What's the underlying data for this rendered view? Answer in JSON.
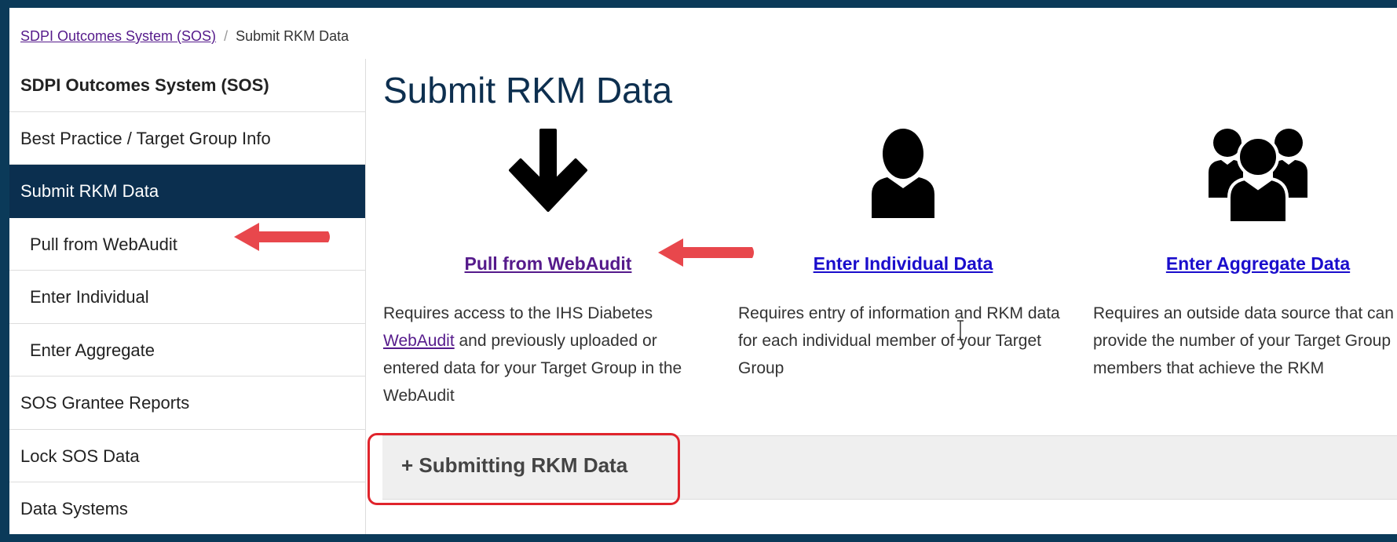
{
  "breadcrumb": {
    "home": "SDPI Outcomes System (SOS)",
    "current": "Submit RKM Data"
  },
  "sidebar": {
    "items": [
      {
        "label": "SDPI Outcomes System (SOS)"
      },
      {
        "label": "Best Practice / Target Group Info"
      },
      {
        "label": "Submit RKM Data"
      },
      {
        "label": "Pull from WebAudit"
      },
      {
        "label": "Enter Individual"
      },
      {
        "label": "Enter Aggregate"
      },
      {
        "label": "SOS Grantee Reports"
      },
      {
        "label": "Lock SOS Data"
      },
      {
        "label": "Data Systems"
      }
    ]
  },
  "main": {
    "title": "Submit RKM Data",
    "cards": [
      {
        "icon": "arrow-down-icon",
        "link": "Pull from WebAudit",
        "desc_pre": "Requires access to the IHS Diabetes ",
        "desc_link": "WebAudit",
        "desc_post": " and previously uploaded or entered data for your Target Group in the WebAudit",
        "link_color": "#551a8b"
      },
      {
        "icon": "user-icon",
        "link": "Enter Individual Data",
        "desc": "Requires entry of information and RKM data for each individual member of your Target Group",
        "link_color": "#1a0dcc"
      },
      {
        "icon": "users-group-icon",
        "link": "Enter Aggregate Data",
        "desc": "Requires an outside data source that can provide the number of your Target Group members that achieve the RKM",
        "link_color": "#1a0dcc"
      }
    ],
    "accordion": {
      "icon": "plus-icon",
      "label": "+ Submitting RKM Data"
    }
  },
  "colors": {
    "frame": "#0b3a59",
    "active": "#0b2f4f",
    "annotation": "#e0242c"
  }
}
